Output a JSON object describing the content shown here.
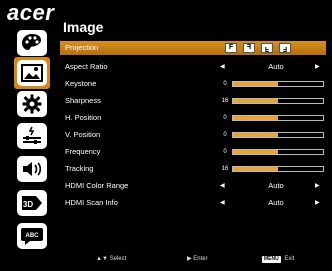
{
  "brand": "acer",
  "page_title": "Image",
  "sidebar": [
    {
      "icon": "palette-icon",
      "active": false
    },
    {
      "icon": "image-icon",
      "active": true
    },
    {
      "icon": "gear-icon",
      "active": false
    },
    {
      "icon": "power-settings-icon",
      "active": false
    },
    {
      "icon": "speaker-icon",
      "active": false
    },
    {
      "icon": "3d-icon",
      "active": false,
      "text": "3D"
    },
    {
      "icon": "language-icon",
      "active": false,
      "text": "ABC"
    }
  ],
  "menu": {
    "projection": {
      "label": "Projection",
      "options": [
        "F",
        "F",
        "F",
        "F"
      ]
    },
    "aspect_ratio": {
      "label": "Aspect Ratio",
      "value": "Auto"
    },
    "keystone": {
      "label": "Keystone",
      "value": "0",
      "level": 0.5
    },
    "sharpness": {
      "label": "Sharpness",
      "value": "16",
      "level": 0.5
    },
    "h_position": {
      "label": "H. Position",
      "value": "0",
      "level": 0.5
    },
    "v_position": {
      "label": "V. Position",
      "value": "0",
      "level": 0.5
    },
    "frequency": {
      "label": "Frequency",
      "value": "0",
      "level": 0.5
    },
    "tracking": {
      "label": "Tracking",
      "value": "16",
      "level": 0.5
    },
    "hdmi_color_range": {
      "label": "HDMI Color Range",
      "value": "Auto"
    },
    "hdmi_scan_info": {
      "label": "HDMI Scan Info",
      "value": "Auto"
    }
  },
  "footer": {
    "select_label": "Select",
    "enter_label": "Enter",
    "menu_key": "MENU",
    "exit_label": "Exit"
  }
}
